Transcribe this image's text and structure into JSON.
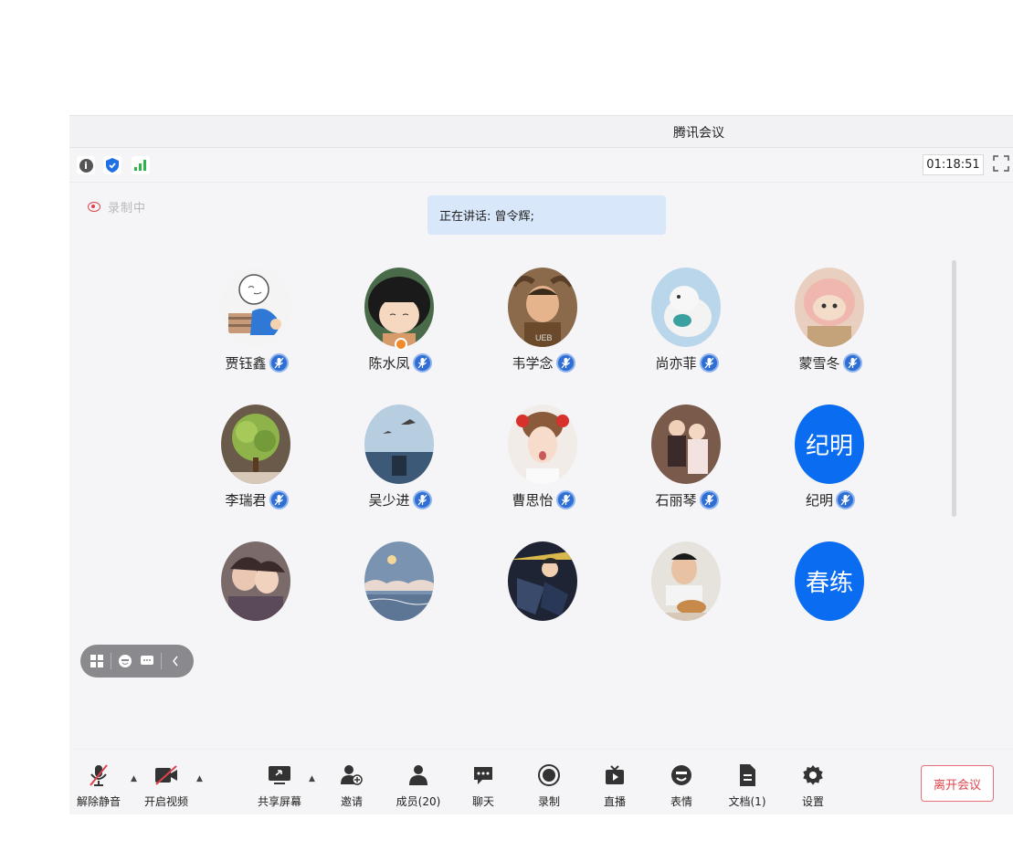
{
  "window": {
    "title": "腾讯会议"
  },
  "infobar": {
    "timer": "01:18:51"
  },
  "recording": {
    "label": "录制中"
  },
  "speaking": {
    "text": "正在讲话: 曾令辉;"
  },
  "participants": [
    {
      "name": "贾钰鑫",
      "avatar": "photo-cartoon-doodle"
    },
    {
      "name": "陈水凤",
      "avatar": "photo-chibi-girl",
      "host": true
    },
    {
      "name": "韦学念",
      "avatar": "photo-person"
    },
    {
      "name": "尚亦菲",
      "avatar": "photo-toy-bird"
    },
    {
      "name": "蒙雪冬",
      "avatar": "photo-plush-toy"
    },
    {
      "name": "李瑞君",
      "avatar": "photo-tree"
    },
    {
      "name": "吴少进",
      "avatar": "photo-seagull"
    },
    {
      "name": "曹思怡",
      "avatar": "photo-young-man"
    },
    {
      "name": "石丽琴",
      "avatar": "photo-children"
    },
    {
      "name": "纪明",
      "avatar_text": "纪明"
    },
    {
      "name": "",
      "avatar": "photo-group"
    },
    {
      "name": "",
      "avatar": "photo-landscape"
    },
    {
      "name": "",
      "avatar": "photo-anime"
    },
    {
      "name": "",
      "avatar": "photo-man-eating"
    },
    {
      "name": "",
      "avatar_text": "春练"
    }
  ],
  "toolbar": {
    "unmute": "解除静音",
    "start_video": "开启视频",
    "share_screen": "共享屏幕",
    "invite": "邀请",
    "members": "成员(20)",
    "chat": "聊天",
    "record": "录制",
    "live": "直播",
    "reactions": "表情",
    "docs": "文档(1)",
    "settings": "设置",
    "leave": "离开会议"
  },
  "colors": {
    "accent": "#0a6cf0",
    "leave_red": "#e0424b",
    "speaking_bg": "#d9e7fb"
  }
}
